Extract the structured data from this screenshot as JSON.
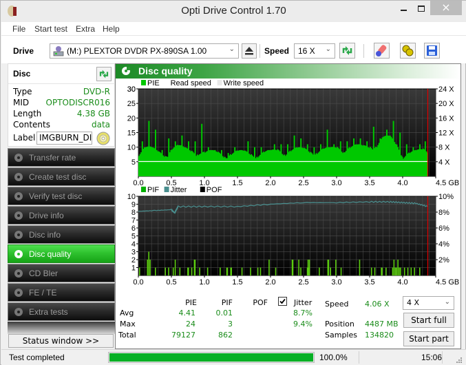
{
  "window": {
    "title": "Opti Drive Control 1.70",
    "controls": {
      "minimize": "–",
      "maximize": "□",
      "close": "×"
    }
  },
  "menu": [
    "File",
    "Start test",
    "Extra",
    "Help"
  ],
  "toolbar": {
    "drive_label": "Drive",
    "drive_value": "(M:)  PLEXTOR DVDR   PX-890SA 1.00",
    "speed_label": "Speed",
    "speed_value": "16 X",
    "icons": [
      "drive-icon",
      "eject-icon",
      "refresh-icon",
      "eraser-icon",
      "settings-icon",
      "save-icon"
    ]
  },
  "disc": {
    "header": "Disc",
    "fields": [
      {
        "key": "Type",
        "value": "DVD-R"
      },
      {
        "key": "MID",
        "value": "OPTODISCR016"
      },
      {
        "key": "Length",
        "value": "4.38 GB"
      },
      {
        "key": "Contents",
        "value": "data"
      }
    ],
    "label_key": "Label",
    "label_value": "IMGBURN_DISC"
  },
  "nav": [
    {
      "label": "Transfer rate",
      "active": false
    },
    {
      "label": "Create test disc",
      "active": false
    },
    {
      "label": "Verify test disc",
      "active": false
    },
    {
      "label": "Drive info",
      "active": false
    },
    {
      "label": "Disc info",
      "active": false
    },
    {
      "label": "Disc quality",
      "active": true
    },
    {
      "label": "CD Bler",
      "active": false
    },
    {
      "label": "FE / TE",
      "active": false
    },
    {
      "label": "Extra tests",
      "active": false
    }
  ],
  "status_window_button": "Status window >>",
  "main": {
    "title": "Disc quality"
  },
  "chart_data": [
    {
      "type": "bar",
      "title": "PIE",
      "legend": [
        {
          "name": "PIE",
          "color": "#00c800"
        },
        {
          "name": "Read speed",
          "color": "#ffffff"
        },
        {
          "name": "Write speed",
          "color": "#e8e8e8"
        }
      ],
      "xlabel": "GB",
      "x_ticks": [
        "0.0",
        "0.5",
        "1.0",
        "1.5",
        "2.0",
        "2.5",
        "3.0",
        "3.5",
        "4.0",
        "4.5 GB"
      ],
      "xlim": [
        0,
        4.5
      ],
      "y_ticks": [
        "5",
        "10",
        "15",
        "20",
        "25",
        "30"
      ],
      "ylim": [
        0,
        30
      ],
      "y2_ticks": [
        "4 X",
        "8 X",
        "12 X",
        "16 X",
        "20 X",
        "24 X"
      ],
      "y2lim": [
        0,
        24
      ],
      "end_marker_gb": 4.38,
      "read_speed_x": 4.06,
      "series": [
        {
          "name": "PIE",
          "x_gb": [
            0.0,
            0.1,
            0.2,
            0.3,
            0.4,
            0.5,
            0.6,
            0.7,
            0.8,
            0.9,
            1.0,
            1.1,
            1.2,
            1.3,
            1.4,
            1.5,
            1.6,
            1.7,
            1.8,
            1.9,
            2.0,
            2.1,
            2.2,
            2.3,
            2.4,
            2.5,
            2.6,
            2.7,
            2.8,
            2.9,
            3.0,
            3.1,
            3.2,
            3.3,
            3.4,
            3.5,
            3.6,
            3.7,
            3.8,
            3.9,
            4.0,
            4.1,
            4.2,
            4.3,
            4.38
          ],
          "baseline": [
            9,
            10,
            9,
            8,
            8,
            10,
            10,
            9,
            9,
            9,
            8,
            8,
            8,
            8,
            8,
            8,
            8,
            8,
            8,
            8,
            8,
            9,
            9,
            9,
            9,
            9,
            9,
            9,
            9,
            9,
            10,
            10,
            10,
            10,
            10,
            11,
            11,
            13,
            13,
            11,
            8,
            8,
            8,
            9,
            9
          ],
          "peaks": [
            12,
            19,
            16,
            9,
            13,
            12,
            14,
            12,
            12,
            18,
            10,
            9,
            9,
            8,
            10,
            9,
            12,
            10,
            10,
            9,
            11,
            11,
            11,
            14,
            13,
            11,
            10,
            11,
            16,
            11,
            12,
            12,
            13,
            13,
            12,
            17,
            13,
            16,
            19,
            15,
            11,
            10,
            11,
            12,
            11
          ]
        }
      ]
    },
    {
      "type": "bar",
      "title": "PIF / Jitter",
      "legend": [
        {
          "name": "PIF",
          "color": "#00b000"
        },
        {
          "name": "Jitter",
          "color": "#4a8f8f"
        },
        {
          "name": "POF",
          "color": "#000000"
        }
      ],
      "xlabel": "GB",
      "x_ticks": [
        "0.0",
        "0.5",
        "1.0",
        "1.5",
        "2.0",
        "2.5",
        "3.0",
        "3.5",
        "4.0",
        "4.5 GB"
      ],
      "xlim": [
        0,
        4.5
      ],
      "y_ticks": [
        "1",
        "2",
        "3",
        "4",
        "5",
        "6",
        "7",
        "8",
        "9",
        "10"
      ],
      "ylim": [
        0,
        10
      ],
      "y2_ticks": [
        "2%",
        "4%",
        "6%",
        "8%",
        "10%"
      ],
      "y2lim": [
        0,
        10
      ],
      "end_marker_gb": 4.38,
      "series": [
        {
          "name": "PIF",
          "x_gb": [
            0.01,
            0.13,
            0.15,
            0.17,
            0.25,
            0.4,
            0.45,
            0.52,
            0.55,
            0.62,
            0.74,
            0.75,
            0.8,
            0.84,
            0.85,
            0.92,
            1.04,
            1.23,
            1.33,
            1.34,
            1.39,
            1.4,
            1.56,
            1.69,
            1.8,
            1.84,
            1.97,
            2.07,
            2.32,
            2.33,
            2.42,
            2.45,
            2.55,
            2.56,
            2.57,
            2.58,
            2.73,
            2.86,
            2.87,
            2.9,
            2.98,
            3.06,
            3.34,
            3.52,
            3.57,
            3.67,
            3.68,
            3.74,
            3.84,
            3.86,
            3.88,
            3.9,
            3.92,
            3.94,
            3.96,
            4.02,
            4.07,
            4.12,
            4.17,
            4.25
          ],
          "values": [
            1,
            2,
            3,
            2,
            1,
            1,
            1,
            1,
            2,
            1,
            1,
            1,
            1,
            2,
            2,
            1,
            1,
            1,
            1,
            1,
            1,
            1,
            1,
            1,
            1,
            1,
            2,
            1,
            2,
            2,
            2,
            1,
            1,
            2,
            1,
            2,
            1,
            2,
            2,
            1,
            2,
            1,
            2,
            1,
            1,
            1,
            1,
            1,
            1,
            2,
            1,
            1,
            2,
            1,
            1,
            1,
            1,
            1,
            1,
            1
          ]
        },
        {
          "name": "Jitter",
          "x_gb": [
            0.0,
            0.25,
            0.5,
            0.55,
            0.6,
            1.0,
            1.5,
            2.0,
            2.5,
            3.0,
            3.5,
            3.8,
            4.0,
            4.2,
            4.38
          ],
          "values": [
            8.1,
            8.2,
            8.3,
            7.9,
            8.7,
            8.7,
            8.7,
            9.0,
            9.2,
            9.2,
            9.3,
            9.3,
            9.2,
            9.1,
            8.7
          ]
        }
      ]
    }
  ],
  "stats": {
    "headers": {
      "pie": "PIE",
      "pif": "PIF",
      "pof": "POF",
      "jitter": "Jitter"
    },
    "jitter_checked": true,
    "rows": [
      {
        "label": "Avg",
        "pie": "4.41",
        "pif": "0.01",
        "jitter": "8.7%"
      },
      {
        "label": "Max",
        "pie": "24",
        "pif": "3",
        "jitter": "9.4%"
      },
      {
        "label": "Total",
        "pie": "79127",
        "pif": "862"
      }
    ],
    "speed_label": "Speed",
    "speed_value": "4.06 X",
    "position_label": "Position",
    "position_value": "4487 MB",
    "samples_label": "Samples",
    "samples_value": "134820",
    "test_speed": "4 X",
    "start_full": "Start full",
    "start_part": "Start part"
  },
  "statusbar": {
    "text": "Test completed",
    "progress_percent": 100.0,
    "progress_label": "100.0%",
    "time": "15:06"
  }
}
